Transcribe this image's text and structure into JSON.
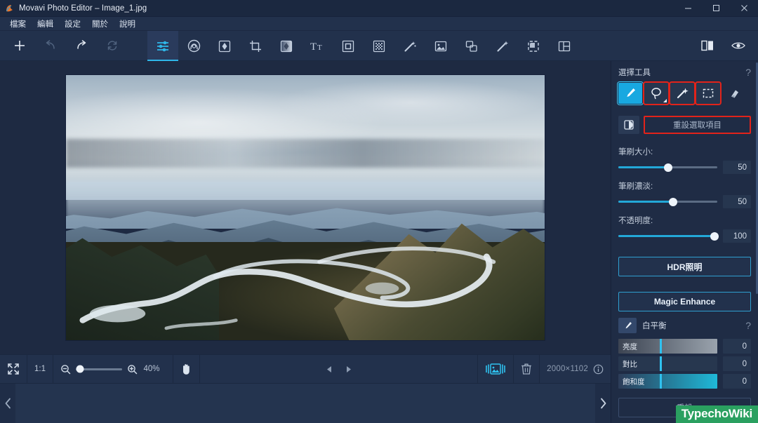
{
  "window": {
    "title": "Movavi Photo Editor – Image_1.jpg",
    "minimize": "–",
    "maximize": "□",
    "close": "✕"
  },
  "menubar": {
    "items": [
      {
        "label": "檔案",
        "name": "menu-file"
      },
      {
        "label": "編輯",
        "name": "menu-edit"
      },
      {
        "label": "設定",
        "name": "menu-settings"
      },
      {
        "label": "關於",
        "name": "menu-about"
      },
      {
        "label": "說明",
        "name": "menu-help"
      }
    ]
  },
  "toolbar": {
    "left": [
      {
        "name": "add-icon",
        "glyph": "+",
        "enabled": true
      },
      {
        "name": "undo-icon",
        "glyph": "↶",
        "enabled": false
      },
      {
        "name": "redo-icon",
        "glyph": "↷",
        "enabled": true
      },
      {
        "name": "reset-all-icon",
        "glyph": "⟳",
        "enabled": false
      }
    ],
    "tabs": [
      {
        "name": "tab-adjust",
        "active": true
      },
      {
        "name": "tab-retouch",
        "active": false
      },
      {
        "name": "tab-effects",
        "active": false
      },
      {
        "name": "tab-crop",
        "active": false
      },
      {
        "name": "tab-filters",
        "active": false
      },
      {
        "name": "tab-text",
        "active": false
      },
      {
        "name": "tab-frame",
        "active": false
      },
      {
        "name": "tab-mosaic",
        "active": false
      },
      {
        "name": "tab-magic-wand",
        "active": false
      },
      {
        "name": "tab-image",
        "active": false
      },
      {
        "name": "tab-layers",
        "active": false
      },
      {
        "name": "tab-magic-cutout",
        "active": false
      },
      {
        "name": "tab-object-removal",
        "active": false
      },
      {
        "name": "tab-collage",
        "active": false
      }
    ],
    "right": [
      {
        "name": "compare-split-icon"
      },
      {
        "name": "preview-eye-icon"
      }
    ]
  },
  "bottombar": {
    "fit_icon": "fit-screen-icon",
    "actual_size_label": "1:1",
    "zoom_out_icon": "zoom-out-icon",
    "zoom_in_icon": "zoom-in-icon",
    "zoom_level": "40%",
    "zoom_slider_percent": 9,
    "hand_tool_icon": "hand-tool-icon",
    "prev_icon": "prev-image-icon",
    "next_icon": "next-image-icon",
    "filmstrip_toggle_icon": "filmstrip-toggle-icon",
    "delete_icon": "trash-icon",
    "dimensions": "2000×1102",
    "info_icon": "info-icon"
  },
  "filmstrip": {
    "prev_icon": "chevron-left-icon",
    "next_icon": "chevron-right-icon"
  },
  "rightpanel": {
    "section_title": "選擇工具",
    "help_glyph": "?",
    "tools": [
      {
        "name": "brush-select-tool",
        "selected": true,
        "highlighted": false
      },
      {
        "name": "lasso-select-tool",
        "selected": false,
        "highlighted": true
      },
      {
        "name": "magic-wand-select-tool",
        "selected": false,
        "highlighted": true
      },
      {
        "name": "rectangle-select-tool",
        "selected": false,
        "highlighted": true
      },
      {
        "name": "eraser-tool",
        "selected": false,
        "highlighted": false
      }
    ],
    "invert_icon": "invert-selection-icon",
    "reset_selection_label": "重設選取項目",
    "sliders": [
      {
        "label": "筆刷大小:",
        "value": "50",
        "percent": 50,
        "name": "brush-size-slider"
      },
      {
        "label": "筆刷濃淡:",
        "value": "50",
        "percent": 55,
        "name": "brush-hardness-slider"
      },
      {
        "label": "不透明度:",
        "value": "100",
        "percent": 97,
        "name": "opacity-slider"
      }
    ],
    "hdr_button": "HDR照明",
    "magic_enhance_button": "Magic Enhance",
    "white_balance_label": "白平衡",
    "white_balance_icon": "eyedropper-icon",
    "white_balance_help": "?",
    "color_sliders": [
      {
        "label": "亮度",
        "value": "0",
        "name": "brightness-slider",
        "handle_percent": 42
      },
      {
        "label": "對比",
        "value": "0",
        "name": "contrast-slider",
        "handle_percent": 42
      },
      {
        "label": "飽和度",
        "value": "0",
        "name": "saturation-slider",
        "handle_percent": 42
      }
    ],
    "reset_button": "重設"
  },
  "watermark": {
    "text": "TypechoWiki"
  },
  "colors": {
    "accent": "#2fb6e8",
    "highlight_red": "#e2231a",
    "panel_bg": "#1f2c45",
    "chrome_bg": "#22314c",
    "canvas_bg": "#1e2a42",
    "watermark_green": "#2aa060"
  }
}
